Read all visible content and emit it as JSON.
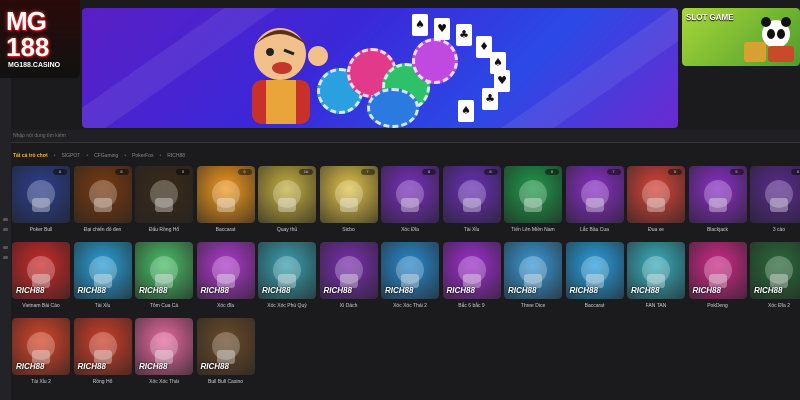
{
  "brand": {
    "logo_top": "MG",
    "logo_bottom": "188",
    "site": "MG188.CASINO"
  },
  "promo": {
    "slot_label": "SLOT GAME"
  },
  "search": {
    "placeholder": "Nhập nội dung tìm kiếm"
  },
  "tabs": [
    {
      "label": "Tất cả trò chơi",
      "active": true
    },
    {
      "label": "SIGPOT",
      "active": false
    },
    {
      "label": "CFGaming",
      "active": false
    },
    {
      "label": "PokerFox",
      "active": false
    },
    {
      "label": "RICH88",
      "active": false
    }
  ],
  "games_row1": [
    {
      "name": "Poker Bull",
      "badge": "6",
      "color": "#2b3f8f"
    },
    {
      "name": "Đại chiến đỏ đen",
      "badge": "8",
      "color": "#7a3a10"
    },
    {
      "name": "Đấu Rồng Hổ",
      "badge": "5",
      "color": "#3a2a18"
    },
    {
      "name": "Baccarat",
      "badge": "6",
      "color": "#f39a1f"
    },
    {
      "name": "Quay thủ",
      "badge": "16",
      "color": "#c6b040"
    },
    {
      "name": "Sicbo",
      "badge": "7",
      "color": "#e2c34a"
    },
    {
      "name": "Xóc Đĩa",
      "badge": "8",
      "color": "#7a2fc0"
    },
    {
      "name": "Tài Xỉu",
      "badge": "8",
      "color": "#6a2fb8"
    },
    {
      "name": "Tiến Lên Miền Nam",
      "badge": "8",
      "color": "#1f9b4a"
    },
    {
      "name": "Lắc Bầu Cua",
      "badge": "7",
      "color": "#8a2fc8"
    },
    {
      "name": "Đua xe",
      "badge": "5",
      "color": "#d7453a"
    },
    {
      "name": "Blackjack",
      "badge": "5",
      "color": "#8a2fc8"
    },
    {
      "name": "3 cào",
      "badge": "8",
      "color": "#5a2a90"
    }
  ],
  "games_row2": [
    {
      "name": "Vietnam Bài Cào",
      "badge": "",
      "color": "#cf2a2a"
    },
    {
      "name": "Tài Xỉu",
      "badge": "",
      "color": "#2aa0d8"
    },
    {
      "name": "Tôm Cua Cá",
      "badge": "",
      "color": "#4ac068"
    },
    {
      "name": "Xóc đĩa",
      "badge": "",
      "color": "#b03ad0"
    },
    {
      "name": "Xóc Xóc Phú Quý",
      "badge": "",
      "color": "#3aa0b0"
    },
    {
      "name": "Xì Dách",
      "badge": "",
      "color": "#7a2fb0"
    },
    {
      "name": "Xóc Xóc Thái 2",
      "badge": "",
      "color": "#2a8ad0"
    },
    {
      "name": "Bắc 6 bắc 9",
      "badge": "",
      "color": "#a02fd0"
    },
    {
      "name": "Three Dice",
      "badge": "",
      "color": "#3a9ad8"
    },
    {
      "name": "Baccarat",
      "badge": "",
      "color": "#2aa0e0"
    },
    {
      "name": "FAN TAN",
      "badge": "",
      "color": "#3ab0c0"
    },
    {
      "name": "PokDeng",
      "badge": "",
      "color": "#d02a8a"
    },
    {
      "name": "Xóc Đĩa 2",
      "badge": "",
      "color": "#2a6a3a"
    }
  ],
  "games_row3": [
    {
      "name": "Tài Xỉu 2",
      "badge": "",
      "color": "#d8462a"
    },
    {
      "name": "Rồng Hổ",
      "badge": "",
      "color": "#d0402a"
    },
    {
      "name": "Xóc Xóc Thái",
      "badge": "",
      "color": "#e86aa0"
    },
    {
      "name": "Bull Bull Casino",
      "badge": "",
      "color": "#6a4a2a"
    }
  ],
  "rich_logo": "RICH88"
}
